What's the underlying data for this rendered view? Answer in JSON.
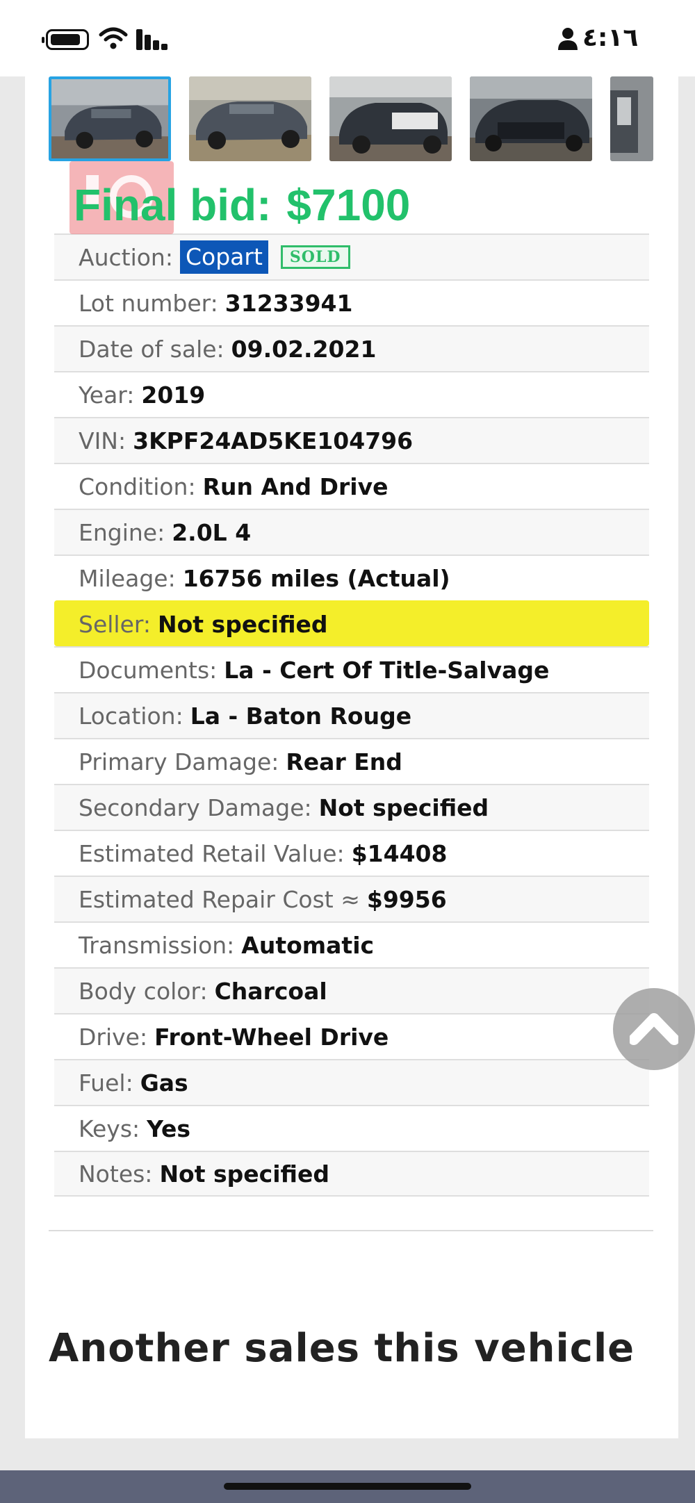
{
  "status_bar": {
    "time": "٤:١٦",
    "icons": [
      "battery-icon",
      "wifi-icon",
      "cellular-signal-icon",
      "person-icon"
    ]
  },
  "gallery": {
    "thumbnails": [
      "car-photo-front-left",
      "car-photo-front",
      "car-photo-rear-left",
      "car-photo-rear-damage",
      "car-photo-interior"
    ],
    "selected_index": 0,
    "selected_border_color": "#27a3e3"
  },
  "final_bid": {
    "label": "Final bid:",
    "amount": "$7100",
    "color": "#22c16b"
  },
  "specs": {
    "auction": {
      "label": "Auction:",
      "value": "Copart",
      "badge": "SOLD"
    },
    "rows": [
      {
        "label": "Lot number:",
        "value": "31233941"
      },
      {
        "label": "Date of sale:",
        "value": "09.02.2021"
      },
      {
        "label": "Year:",
        "value": "2019"
      },
      {
        "label": "VIN:",
        "value": "3KPF24AD5KE104796"
      },
      {
        "label": "Condition:",
        "value": "Run And Drive"
      },
      {
        "label": "Engine:",
        "value": "2.0L 4"
      },
      {
        "label": "Mileage:",
        "value": "16756 miles (Actual)"
      },
      {
        "label": "Seller:",
        "value": "Not specified"
      },
      {
        "label": "Documents:",
        "value": "La - Cert Of Title-Salvage"
      },
      {
        "label": "Location:",
        "value": "La - Baton Rouge"
      },
      {
        "label": "Primary Damage:",
        "value": "Rear End"
      },
      {
        "label": "Secondary Damage:",
        "value": "Not specified"
      },
      {
        "label": "Estimated Retail Value:",
        "value": "$14408"
      },
      {
        "label": "Estimated Repair Cost ≈",
        "value": "$9956"
      },
      {
        "label": "Transmission:",
        "value": "Automatic"
      },
      {
        "label": "Body color:",
        "value": "Charcoal"
      },
      {
        "label": "Drive:",
        "value": "Front-Wheel Drive"
      },
      {
        "label": "Fuel:",
        "value": "Gas"
      },
      {
        "label": "Keys:",
        "value": "Yes"
      },
      {
        "label": "Notes:",
        "value": "Not specified"
      }
    ],
    "highlight_color": "#f4ee2a"
  },
  "another_sales": {
    "heading": "Another sales this vehicle"
  },
  "scroll_top": {
    "icon": "chevron-up-icon"
  },
  "colors": {
    "copart_blue": "#0d57b7",
    "sold_green": "#2fbd6a",
    "bottom_bar": "#5d6379"
  }
}
